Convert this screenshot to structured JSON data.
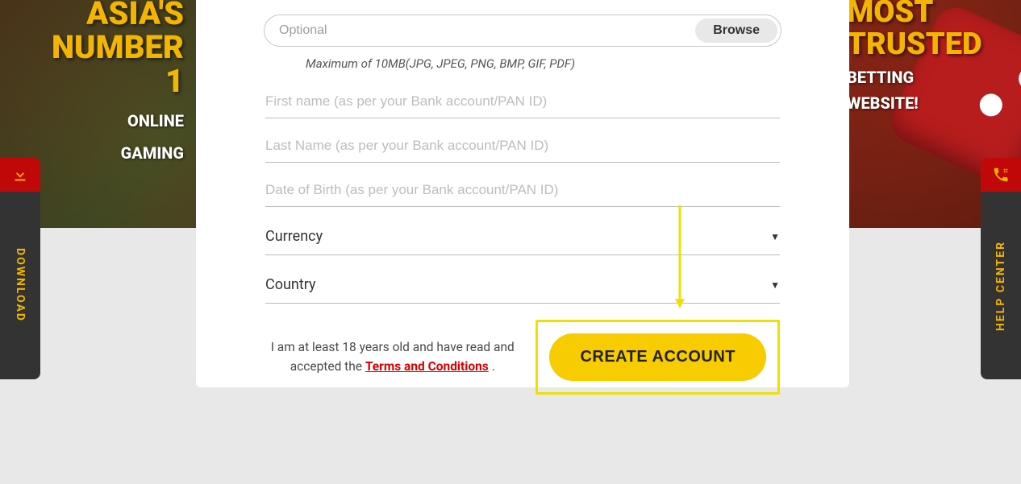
{
  "banner": {
    "left_line1": "ASIA'S",
    "left_line2": "NUMBER",
    "left_line3": "1",
    "left_sub1": "ONLINE",
    "left_sub2": "GAMING",
    "right_line1": "MOST",
    "right_line2": "TRUSTED",
    "right_sub1": "BETTING",
    "right_sub2": "WEBSITE!"
  },
  "sidetabs": {
    "left_label": "DOWNLOAD",
    "right_label": "HELP CENTER"
  },
  "form": {
    "file_placeholder": "Optional",
    "browse_label": "Browse",
    "file_helper": "Maximum of 10MB(JPG, JPEG, PNG, BMP, GIF, PDF)",
    "first_name_placeholder": "First name (as per your Bank account/PAN ID)",
    "last_name_placeholder": "Last Name (as per your Bank account/PAN ID)",
    "dob_placeholder": "Date of Birth (as per your Bank account/PAN ID)",
    "currency_label": "Currency",
    "country_label": "Country",
    "consent_prefix": "I am at least 18 years old and have read and accepted the ",
    "tnc_label": "Terms and Conditions",
    "consent_suffix": " .",
    "create_label": "CREATE ACCOUNT"
  }
}
